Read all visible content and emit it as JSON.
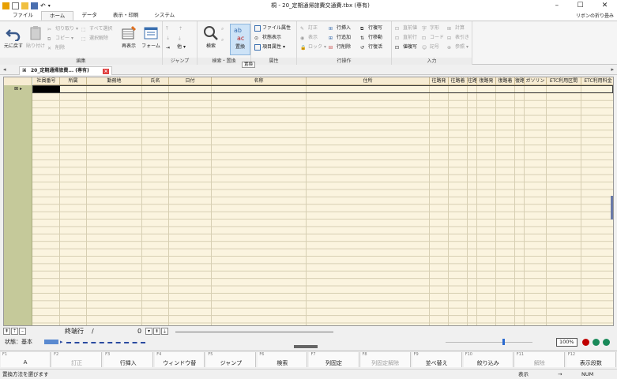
{
  "window": {
    "title": "桐 - 20_定期通帰旅費交通費.tbx (専有)",
    "controls": {
      "minimize": "–",
      "maximize": "☐",
      "close": "✕"
    }
  },
  "ribbon_tabs": [
    "ファイル",
    "ホーム",
    "データ",
    "表示・印刷",
    "システム"
  ],
  "ribbon_active_tab": "ホーム",
  "ribbon_collapse_label": "リボンの折り畳み",
  "ribbon": {
    "edit": {
      "label": "編集",
      "undo": "元に戻す",
      "paste": "貼り付け",
      "cut": "切り取り",
      "copy": "コピー",
      "delete": "削除",
      "select_all": "すべて選択",
      "deselect": "選択解除",
      "redisplay": "再表示",
      "form": "フォーム"
    },
    "jump": {
      "label": "ジャンプ",
      "items": [
        "",
        "",
        "",
        "",
        "",
        "",
        "他"
      ]
    },
    "search": {
      "label": "検索・置換",
      "search": "検索",
      "replace": "置換"
    },
    "attributes": {
      "label": "属性",
      "file_attr": "ファイル属性",
      "status_display": "状態表示",
      "item_attr": "項目属性"
    },
    "row_ops": {
      "label": "行操作",
      "correct": "訂正",
      "display": "表示",
      "lock": "ロック",
      "insert_row": "行挿入",
      "add_row": "行追加",
      "delete_row": "行削除",
      "copy_row": "行複写",
      "move_row": "行移動",
      "return_row": "行復活"
    },
    "input": {
      "label": "入力",
      "prev_input": "直前値",
      "prev_row": "直前行",
      "duplicate": "値複写",
      "font": "字形",
      "code": "コード",
      "memo": "記号",
      "calc": "計算",
      "table_ref": "表引き",
      "reference": "参照"
    }
  },
  "tooltip": "置換",
  "document_tab": {
    "title": "20_定期通帰旅費... (専有)",
    "close": "×"
  },
  "columns": [
    "社員番号",
    "所属",
    "勤務地",
    "氏名",
    "日付",
    "名称",
    "住所",
    "往路発",
    "往路着",
    "往路",
    "復路発",
    "復路着",
    "復路",
    "ガソリン",
    "ETC利用区間",
    "ETC利用料金"
  ],
  "row_selector": "⊠ ▸",
  "nav": {
    "end_row_label": "終端行",
    "slash": "/",
    "count": "0"
  },
  "status": {
    "state_label": "状態：基本",
    "zoom": "100%"
  },
  "fkeys": [
    {
      "fn": "F1",
      "label": "A",
      "enabled": true
    },
    {
      "fn": "F2",
      "label": "訂正",
      "enabled": false
    },
    {
      "fn": "F3",
      "label": "行挿入",
      "enabled": true
    },
    {
      "fn": "F4",
      "label": "ウィンドウ替",
      "enabled": true
    },
    {
      "fn": "F5",
      "label": "ジャンプ",
      "enabled": true
    },
    {
      "fn": "F6",
      "label": "検索",
      "enabled": true
    },
    {
      "fn": "F7",
      "label": "列固定",
      "enabled": true
    },
    {
      "fn": "F8",
      "label": "列固定解除",
      "enabled": false
    },
    {
      "fn": "F9",
      "label": "並べ替え",
      "enabled": true
    },
    {
      "fn": "F10",
      "label": "絞り込み",
      "enabled": true
    },
    {
      "fn": "F11",
      "label": "解除",
      "enabled": false
    },
    {
      "fn": "F12",
      "label": "表示段数",
      "enabled": true
    }
  ],
  "bottom": {
    "hint": "置換方法を選びます",
    "mode": "表示",
    "arrow": "→",
    "numlock": "NUM"
  },
  "colors": {
    "grid_bg": "#fbf4df",
    "header_bg": "#f7ecd3",
    "row_header": "#c5c99a",
    "dot_red": "#c00000",
    "dot_green": "#1a8a5a"
  }
}
